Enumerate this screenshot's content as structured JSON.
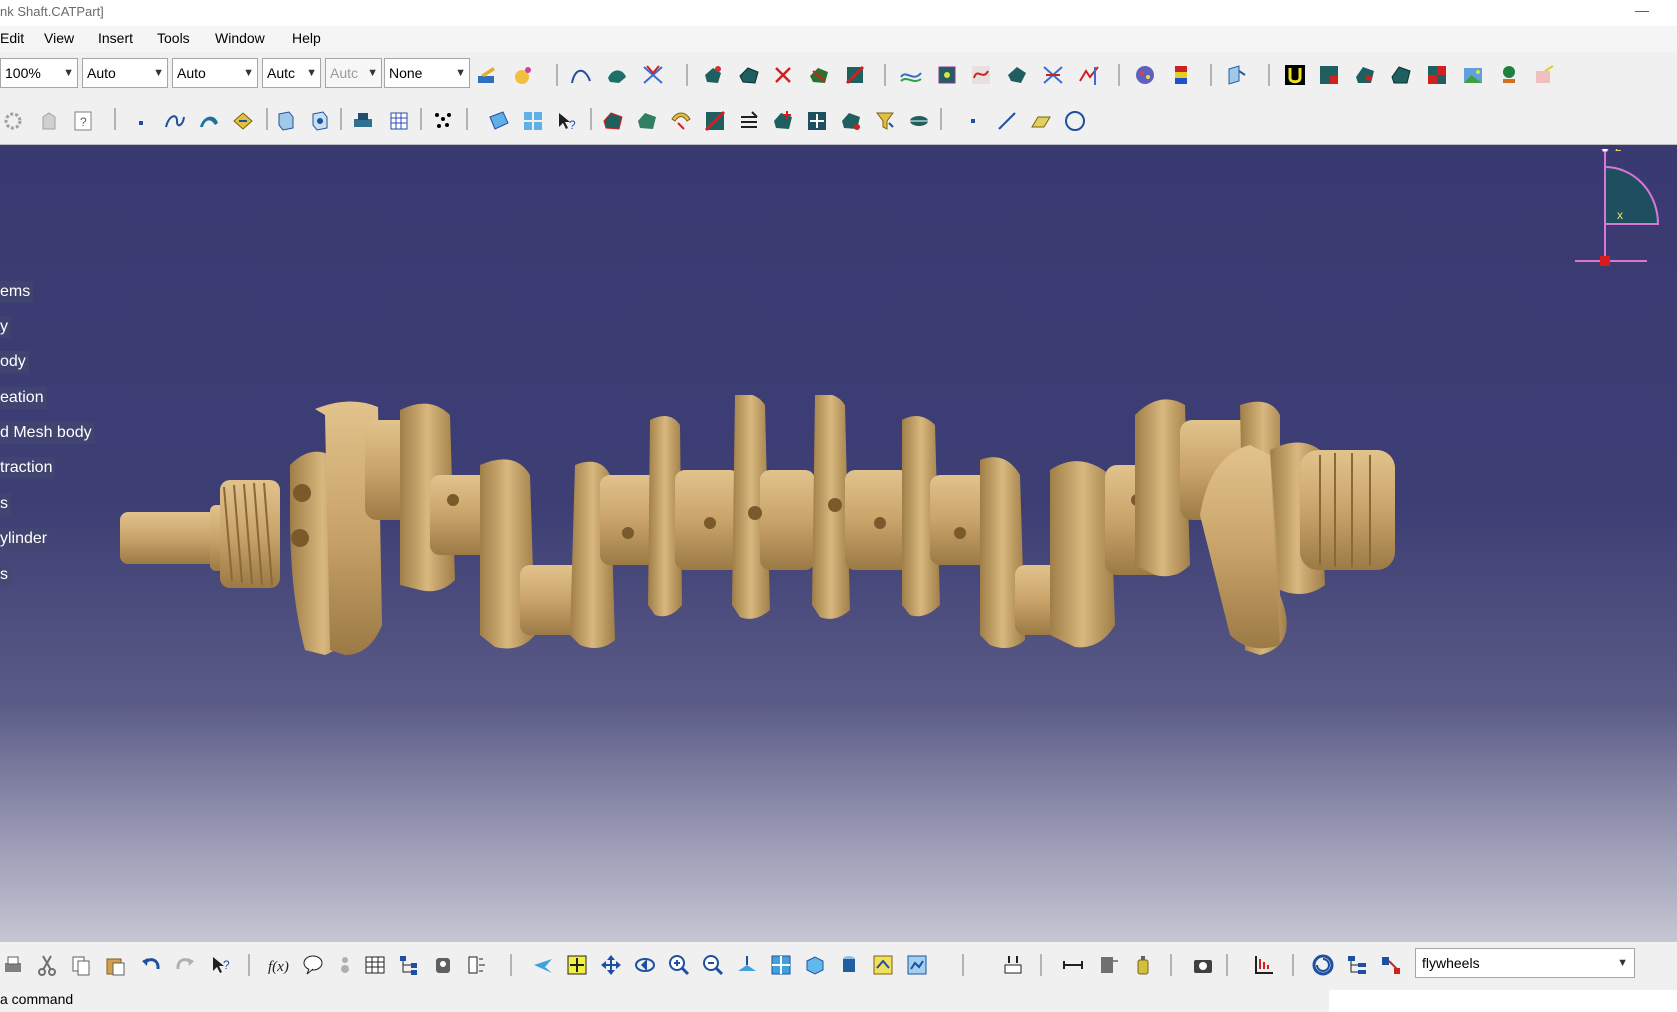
{
  "window": {
    "title": "nk Shaft.CATPart]",
    "minimize_glyph": "—"
  },
  "menu": [
    "Edit",
    "View",
    "Insert",
    "Tools",
    "Window",
    "Help"
  ],
  "toolbar1": {
    "combos": [
      {
        "value": "100%",
        "enabled": true
      },
      {
        "value": "Auto",
        "enabled": true
      },
      {
        "value": "Auto",
        "enabled": true
      },
      {
        "value": "Autc",
        "enabled": true
      },
      {
        "value": "Autc",
        "enabled": false
      },
      {
        "value": "None",
        "enabled": true
      }
    ]
  },
  "tree_items": [
    "ems",
    "y",
    "ody",
    "eation",
    "d Mesh body",
    "traction",
    "s",
    "ylinder",
    "s"
  ],
  "compass": {
    "z_label": "z",
    "x_label": "x"
  },
  "bottom_toolbar": {
    "filter_value": "flywheels"
  },
  "status": {
    "message": "a command"
  },
  "colors": {
    "viewport_top": "#3a3a72",
    "part": "#c9a46a",
    "compass_fill": "#1f4f5e",
    "compass_axis": "#d877d8"
  }
}
